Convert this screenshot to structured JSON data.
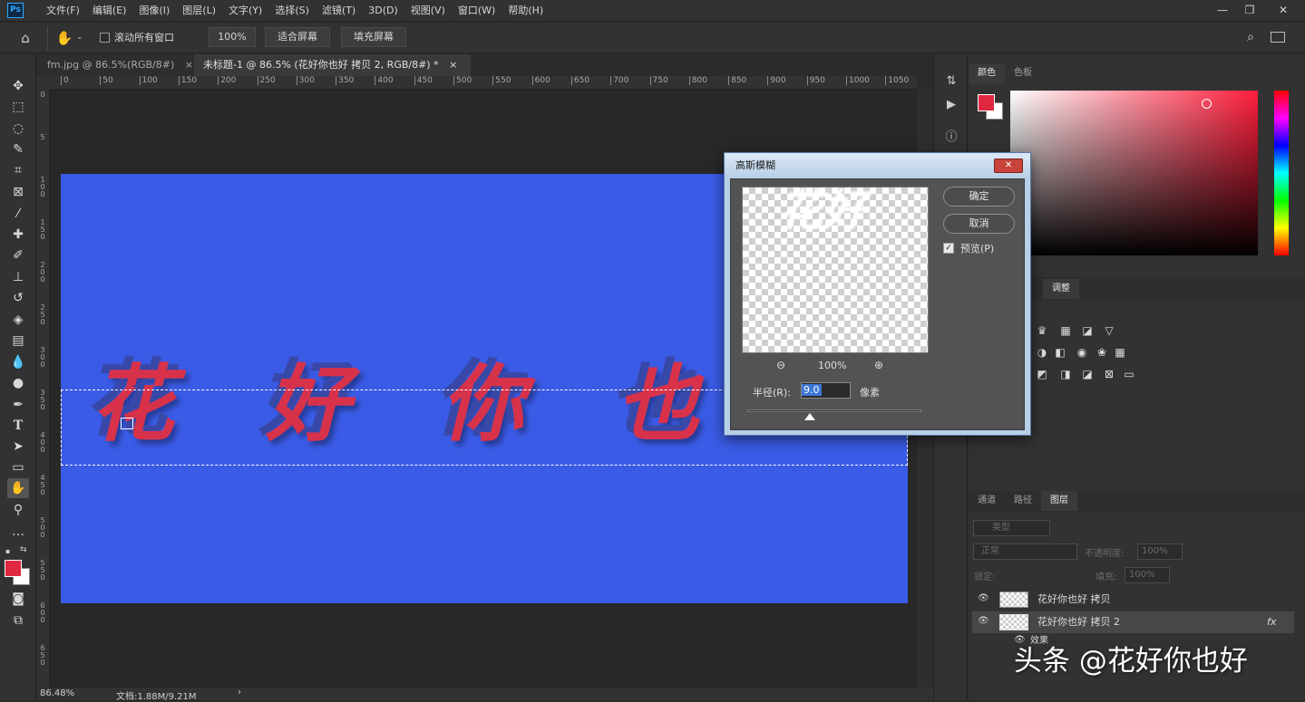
{
  "app": {
    "logo": "Ps"
  },
  "menu": [
    "文件(F)",
    "编辑(E)",
    "图像(I)",
    "图层(L)",
    "文字(Y)",
    "选择(S)",
    "滤镜(T)",
    "3D(D)",
    "视图(V)",
    "窗口(W)",
    "帮助(H)"
  ],
  "window_controls": {
    "minimize": "—",
    "restore": "❐",
    "close": "✕"
  },
  "options": {
    "scroll_all_label": "滚动所有窗口",
    "zoom_value": "100%",
    "fit_screen": "适合屏幕",
    "fill_screen": "填充屏幕"
  },
  "tabs": [
    {
      "label": "fm.jpg @ 86.5%(RGB/8#)",
      "close": "×"
    },
    {
      "label": "未标题-1 @ 86.5% (花好你也好 拷贝 2, RGB/8#) *",
      "close": "×"
    }
  ],
  "ruler_h_ticks": [
    "0",
    "50",
    "100",
    "150",
    "200",
    "250",
    "300",
    "350",
    "400",
    "450",
    "500",
    "550",
    "600",
    "650",
    "700",
    "750",
    "800",
    "850",
    "900",
    "950",
    "1000",
    "1050"
  ],
  "ruler_v_ticks": [
    "0",
    "5",
    "1\n0\n0",
    "1\n5\n0",
    "2\n0\n0",
    "2\n5\n0",
    "3\n0\n0",
    "3\n5\n0",
    "4\n0\n0",
    "4\n5\n0",
    "5\n0\n0",
    "5\n5\n0",
    "6\n0\n0",
    "6\n5\n0"
  ],
  "canvas": {
    "background": "#3a5be6",
    "chars": [
      "花",
      "好",
      "你",
      "也"
    ],
    "text_color": "#d8324a",
    "shadow_color": "#3848a8"
  },
  "status": {
    "zoom": "86.48%",
    "doc": "文档:1.88M/9.21M",
    "arrow": "›"
  },
  "dialog": {
    "title": "高斯模糊",
    "close": "✕",
    "ok": "确定",
    "cancel": "取消",
    "preview_label": "预览(P)",
    "preview_checked": true,
    "zoom_pct": "100%",
    "radius_label": "半径(R):",
    "radius_value": "9.0",
    "radius_unit": "像素",
    "radius_slider": 0.36,
    "preview_text": "花好"
  },
  "panels": {
    "color_tabs": [
      "颜色",
      "色板"
    ],
    "adjust_tab": "调整",
    "layer_tabs": [
      "通道",
      "路径",
      "图层"
    ],
    "filter_kind": "类型",
    "blend_mode": "正常",
    "opacity_label": "不透明度:",
    "opacity_value": "100%",
    "lock_label": "锁定:",
    "fill_label": "填充:",
    "fill_value": "100%",
    "fg_color": "#e02840",
    "bg_color": "#ffffff"
  },
  "layers": [
    {
      "name": "花好你也好  拷贝",
      "visible": true,
      "selected": false
    },
    {
      "name": "花好你也好  拷贝 2",
      "visible": true,
      "selected": true,
      "fx": "fx"
    },
    {
      "name": "效果",
      "visible": true,
      "selected": false,
      "sub": true
    }
  ],
  "watermark": "头条 @花好你也好"
}
